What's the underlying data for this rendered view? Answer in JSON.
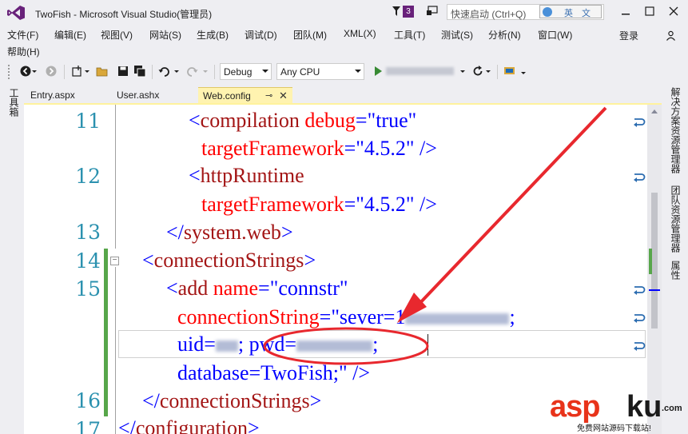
{
  "window": {
    "title": "TwoFish - Microsoft Visual Studio(管理员)",
    "notification_count": "3",
    "quick_launch_placeholder": "快速启动 (Ctrl+Q)",
    "ime_label": "英 文"
  },
  "menu": {
    "items": [
      "文件(F)",
      "编辑(E)",
      "视图(V)",
      "网站(S)",
      "生成(B)",
      "调试(D)",
      "团队(M)",
      "XML(X)",
      "工具(T)",
      "测试(S)",
      "分析(N)",
      "窗口(W)"
    ],
    "help": "帮助(H)",
    "login": "登录"
  },
  "toolbar": {
    "configuration": "Debug",
    "platform": "Any CPU"
  },
  "left_panel": {
    "toolbox_label": "工具箱"
  },
  "right_panel": {
    "tabs": [
      "解决方案资源管理器",
      "团队资源管理器",
      "属性"
    ]
  },
  "tabs": {
    "items": [
      {
        "label": "Entry.aspx",
        "active": false
      },
      {
        "label": "User.ashx",
        "active": false
      },
      {
        "label": "Web.config",
        "active": true
      }
    ]
  },
  "editor": {
    "line_numbers": [
      "11",
      "12",
      "13",
      "14",
      "15",
      "16",
      "17"
    ],
    "lines": {
      "l11a": {
        "open": "<",
        "tag": "compilation",
        "attr": "debug",
        "eq": "=",
        "val": "\"true\""
      },
      "l11b": {
        "attr": "targetFramework",
        "eq": "=",
        "val": "\"4.5.2\"",
        "close": "/>"
      },
      "l12a": {
        "open": "<",
        "tag": "httpRuntime"
      },
      "l12b": {
        "attr": "targetFramework",
        "eq": "=",
        "val": "\"4.5.2\"",
        "close": "/>"
      },
      "l13": {
        "open": "</",
        "tag": "system.web",
        "close": ">"
      },
      "l14": {
        "open": "<",
        "tag": "connectionStrings",
        "close": ">"
      },
      "l15a": {
        "open": "<",
        "tag": "add",
        "attr": "name",
        "eq": "=",
        "val": "\"connstr\""
      },
      "l15b": {
        "attr": "connectionString",
        "eq": "=",
        "val_start": "\"sever=1",
        "val_end": ";"
      },
      "l15c": {
        "uid": "uid=",
        "sep": ";",
        "pwd": " pwd=",
        "end": ";"
      },
      "l15d": {
        "text": "database=TwoFish;\"",
        "close": "/>"
      },
      "l16": {
        "open": "</",
        "tag": "connectionStrings",
        "close": ">"
      },
      "l17": {
        "open": "</",
        "tag": "configuration",
        "close": ">"
      }
    }
  },
  "watermark": {
    "brand_red": "asp",
    "brand_dark": "ku",
    "tld": ".com",
    "tagline": "免费网站源码下载站!"
  },
  "colors": {
    "accent": "#68217a",
    "tag": "#a31515",
    "attribute": "#ff0000",
    "value": "#0000ff",
    "line_number": "#2b91af",
    "change_bar": "#57a64a",
    "annotation": "#e8282e",
    "active_tab": "#fff3b0"
  }
}
